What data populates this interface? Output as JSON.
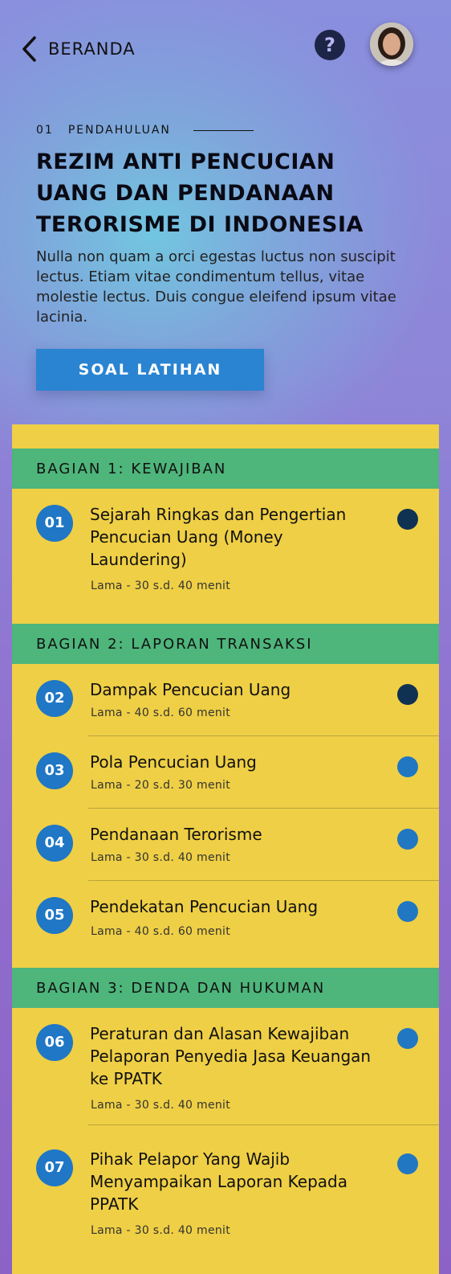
{
  "header": {
    "back_label": "BERANDA",
    "help_label": "?"
  },
  "hero": {
    "kicker_num": "01",
    "kicker_label": "PENDAHULUAN",
    "title": "REZIM ANTI PENCUCIAN UANG DAN PENDANAAN TERORISME DI INDONESIA",
    "description": "Nulla non quam a orci egestas luctus non suscipit lectus. Etiam vitae condimentum tellus, vitae molestie lectus. Duis congue eleifend ipsum vitae lacinia.",
    "cta_label": "SOAL LATIHAN"
  },
  "colors": {
    "panel": "#efcf45",
    "section": "#4eb57b",
    "badge": "#1f77c5",
    "cta": "#2a84d1",
    "dot_done": "#0f3152",
    "dot_todo": "#2177c2"
  },
  "sections": [
    {
      "label": "BAGIAN 1: KEWAJIBAN",
      "items": [
        {
          "num": "01",
          "title": "Sejarah Ringkas dan Pengertian Pencucian Uang (Money Laundering)",
          "meta": "Lama - 30 s.d. 40 menit",
          "status": "done"
        }
      ]
    },
    {
      "label": "BAGIAN 2: LAPORAN TRANSAKSI",
      "items": [
        {
          "num": "02",
          "title": "Dampak Pencucian Uang",
          "meta": "Lama - 40 s.d. 60 menit",
          "status": "done"
        },
        {
          "num": "03",
          "title": "Pola Pencucian Uang",
          "meta": "Lama - 20 s.d. 30 menit",
          "status": "todo"
        },
        {
          "num": "04",
          "title": "Pendanaan Terorisme",
          "meta": "Lama - 30 s.d. 40 menit",
          "status": "todo"
        },
        {
          "num": "05",
          "title": "Pendekatan Pencucian Uang",
          "meta": "Lama - 40 s.d. 60 menit",
          "status": "todo"
        }
      ]
    },
    {
      "label": "BAGIAN 3: DENDA DAN HUKUMAN",
      "items": [
        {
          "num": "06",
          "title": "Peraturan dan Alasan Kewajiban Pelaporan Penyedia Jasa Keuangan ke PPATK",
          "meta": "Lama - 30 s.d. 40 menit",
          "status": "todo"
        },
        {
          "num": "07",
          "title": "Pihak Pelapor Yang Wajib Menyampaikan Laporan Kepada PPATK",
          "meta": "Lama - 30 s.d. 40 menit",
          "status": "todo"
        }
      ]
    }
  ]
}
